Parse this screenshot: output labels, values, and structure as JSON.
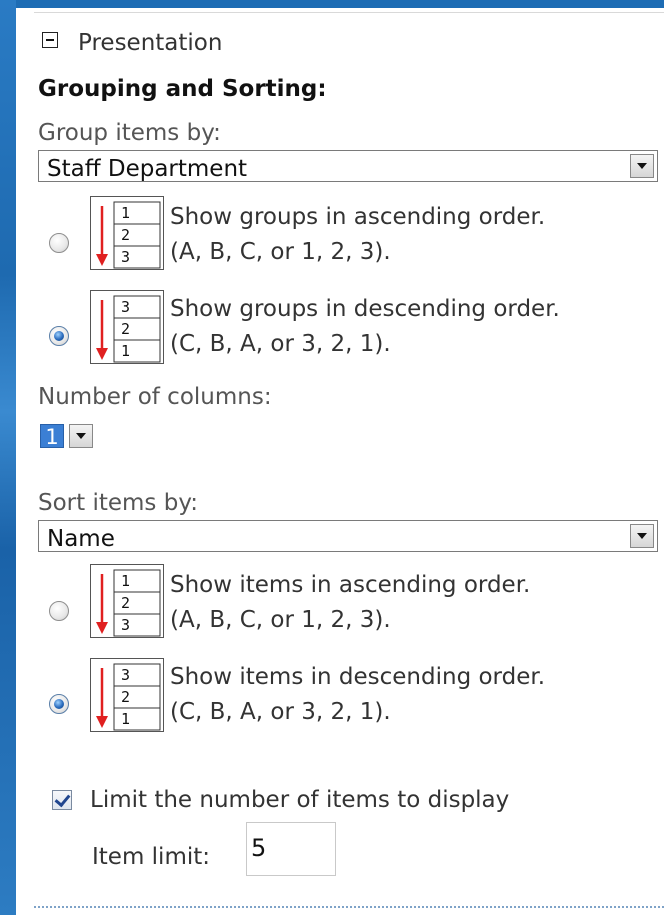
{
  "presentation": {
    "header": "Presentation",
    "icon": "collapse-icon"
  },
  "grouping": {
    "title": "Grouping and Sorting:",
    "group_label": "Group items by:",
    "group_value": "Staff Department",
    "asc": {
      "line1": "Show groups in ascending order.",
      "line2": "(A, B, C, or 1, 2, 3).",
      "selected": false
    },
    "desc": {
      "line1": "Show groups in descending order.",
      "line2": "(C, B, A, or 3, 2, 1).",
      "selected": true
    },
    "columns_label": "Number of columns:",
    "columns_value": "1"
  },
  "sorting": {
    "sort_label": "Sort items by:",
    "sort_value": "Name",
    "asc": {
      "line1": "Show items in ascending order.",
      "line2": "(A, B, C, or 1, 2, 3).",
      "selected": false
    },
    "desc": {
      "line1": "Show items in descending order.",
      "line2": "(C, B, A, or 3, 2, 1).",
      "selected": true
    }
  },
  "limit": {
    "checkbox_label": "Limit the number of items to display",
    "checked": true,
    "item_limit_label": "Item limit:",
    "item_limit_value": "5"
  },
  "sort_icon_digits": {
    "ascending": [
      "1",
      "2",
      "3"
    ],
    "descending": [
      "3",
      "2",
      "1"
    ]
  },
  "colors": {
    "background": "#1f6fb8",
    "panel": "#ffffff",
    "arrow": "#e02020",
    "selected_number": "#3b7fd4"
  }
}
